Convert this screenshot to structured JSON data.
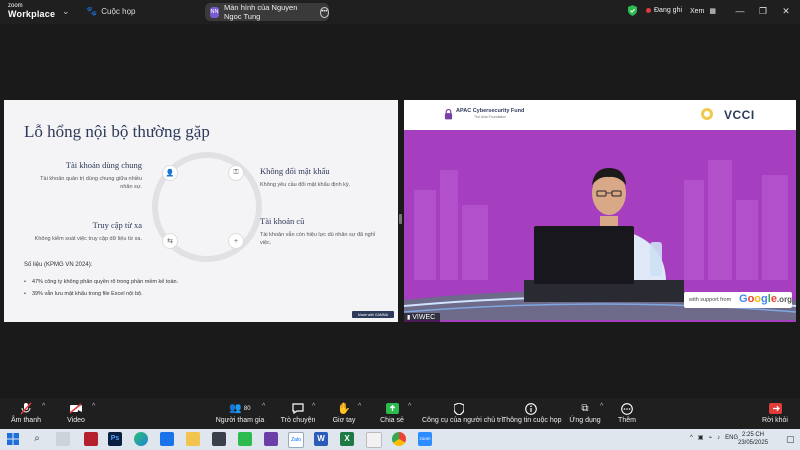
{
  "app": {
    "logo_top": "zoom",
    "logo_bottom": "Workplace",
    "meetings_label": "Cuộc họp",
    "share_badge": "NN",
    "share_label": "Màn hình của Nguyen Ngoc Tung",
    "recording": "Đang ghi",
    "view": "Xem",
    "win_minimize": "—",
    "win_restore": "❐",
    "win_close": "✕"
  },
  "slide": {
    "title": "Lỗ hổng nội bộ thường gặp",
    "items": [
      {
        "title": "Tài khoản dùng chung",
        "desc": "Tài khoản quản trị dùng chung giữa nhiều nhân sự."
      },
      {
        "title": "Không đổi mật khẩu",
        "desc": "Không yêu cầu đổi mật khẩu định kỳ."
      },
      {
        "title": "Truy cập từ xa",
        "desc": "Không kiểm soát việc truy cập dữ liệu từ xa."
      },
      {
        "title": "Tài khoản cũ",
        "desc": "Tài khoản vẫn còn hiệu lực dù nhân sự đã nghỉ việc."
      }
    ],
    "stats_title": "Số liệu (KPMG VN 2024):",
    "stats": [
      "47% công ty không phân quyền rõ trong phần mềm kế toán.",
      "39% vẫn lưu mật khẩu trong file Excel nội bộ."
    ],
    "watermark": "Made with GAMMA"
  },
  "video": {
    "sponsor": "APAC Cybersecurity Fund",
    "sponsor_sub": "The Asia Foundation",
    "partner": "VCCI",
    "support_text": "with support from",
    "support_brand": [
      "G",
      "o",
      "o",
      "g",
      "l",
      "e",
      ".org"
    ],
    "name": "VIWEC"
  },
  "toolbar": {
    "mute": "Âm thanh",
    "video": "Video",
    "participants": "Người tham gia",
    "participants_count": "80",
    "chat": "Trò chuyện",
    "raise_hand": "Giơ tay",
    "share": "Chia sẻ",
    "host_tools": "Công cụ của người chủ trì",
    "meeting_info": "Thông tin cuộc họp",
    "apps": "Ứng dụng",
    "more": "Thêm",
    "leave": "Rời khỏi"
  },
  "taskbar": {
    "lang": "ENG",
    "time": "2:25 CH",
    "date": "23/05/2025",
    "zalo": "Zalo",
    "zoom": "zoom"
  },
  "colors": {
    "accent_purple": "#a63ec0",
    "recording_red": "#e23b3b",
    "slide_navy": "#2e3a5a",
    "shield_green": "#2dbb4f"
  }
}
